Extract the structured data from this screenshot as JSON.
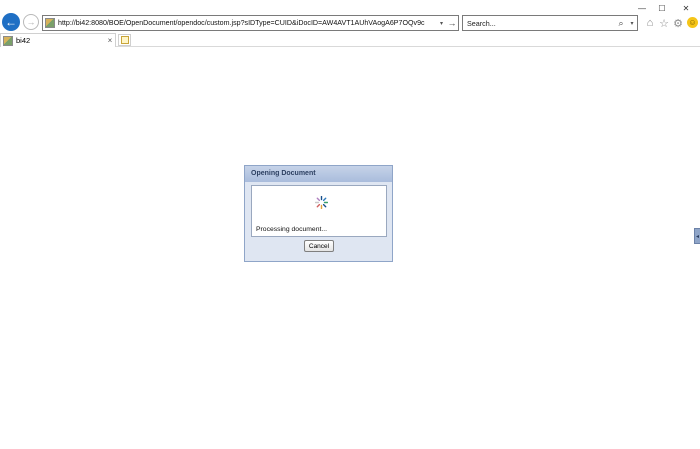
{
  "window": {
    "minimize_glyph": "—",
    "maximize_glyph": "☐",
    "close_glyph": "✕"
  },
  "toolbar": {
    "back_glyph": "←",
    "forward_glyph": "→",
    "address": {
      "url": "http://bi42:8080/BOE/OpenDocument/opendoc/custom.jsp?sIDType=CUID&iDocID=AW4AVT1AUhVAogA6P7OQv9c",
      "dropdown_glyph": "▾",
      "go_glyph": "→"
    },
    "search": {
      "placeholder": "Search...",
      "search_glyph": "⌕",
      "dropdown_glyph": "▾"
    },
    "home_glyph": "⌂",
    "favorites_glyph": "☆",
    "settings_glyph": "⚙",
    "feedback_glyph": "☺"
  },
  "tabs": [
    {
      "label": "bi42",
      "close_glyph": "×"
    }
  ],
  "dialog": {
    "title": "Opening Document",
    "status": "Processing document...",
    "cancel_label": "Cancel"
  },
  "side_panel": {
    "toggle_glyph": "◂"
  }
}
